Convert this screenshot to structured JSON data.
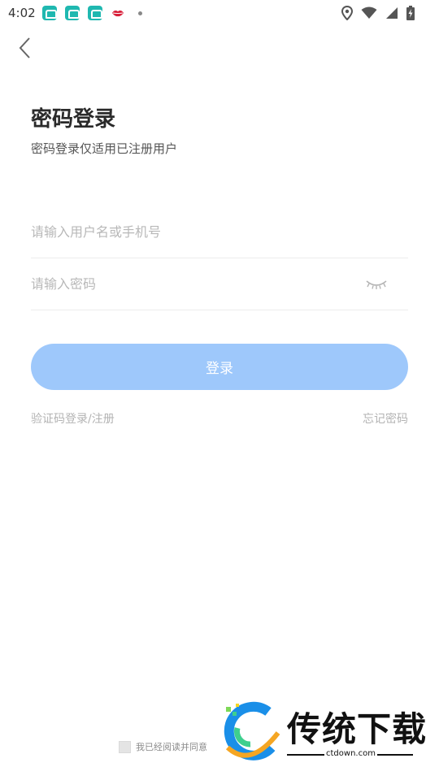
{
  "status_bar": {
    "time": "4:02",
    "notification_icons": [
      "car-app-icon",
      "car-app-icon",
      "car-app-icon",
      "lips-icon",
      "dot-icon"
    ],
    "right_icons": [
      "location-icon",
      "wifi-icon",
      "signal-icon",
      "battery-charging-icon"
    ]
  },
  "header": {
    "back_icon": "chevron-left-icon"
  },
  "login": {
    "title": "密码登录",
    "subtitle": "密码登录仅适用已注册用户",
    "username_placeholder": "请输入用户名或手机号",
    "password_placeholder": "请输入密码",
    "password_toggle_icon": "eye-closed-icon",
    "submit_label": "登录",
    "sms_login_link": "验证码登录/注册",
    "forgot_password_link": "忘记密码"
  },
  "agreement": {
    "text": "我已经阅读并同意"
  },
  "watermark": {
    "title": "传统下载",
    "url": "ctdown.com"
  },
  "colors": {
    "button_bg": "#9ec8fb",
    "link_text": "#b3b3b3",
    "title_text": "#2a2a2a",
    "notification_accent": "#1fb8b0"
  }
}
